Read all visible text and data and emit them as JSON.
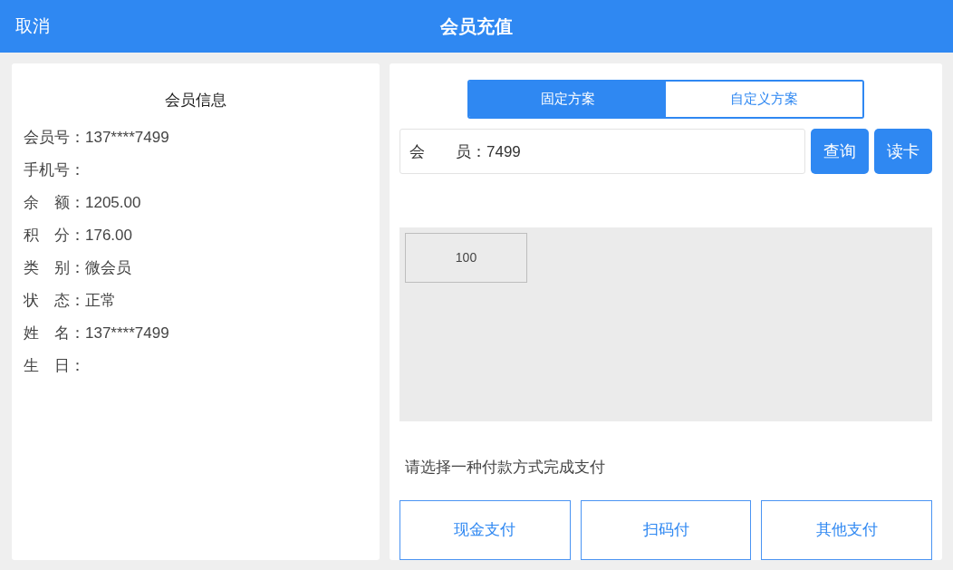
{
  "header": {
    "cancel": "取消",
    "title": "会员充值"
  },
  "member_info": {
    "title": "会员信息",
    "rows": [
      {
        "label": "会员号：",
        "value": "137****7499"
      },
      {
        "label": "手机号：",
        "value": ""
      },
      {
        "label": "余　额：",
        "value": "1205.00"
      },
      {
        "label": "积　分：",
        "value": "176.00"
      },
      {
        "label": "类　别：",
        "value": "微会员"
      },
      {
        "label": "状　态：",
        "value": "正常"
      },
      {
        "label": "姓　名：",
        "value": "137****7499"
      },
      {
        "label": "生　日：",
        "value": ""
      }
    ]
  },
  "tabs": [
    {
      "label": "固定方案",
      "selected": true
    },
    {
      "label": "自定义方案",
      "selected": false
    }
  ],
  "member_field": {
    "label": "会　　员：",
    "value": "7499"
  },
  "actions": [
    "查询",
    "读卡"
  ],
  "plans": [
    "100"
  ],
  "prompt": "请选择一种付款方式完成支付",
  "payments": [
    "现金支付",
    "扫码付",
    "其他支付"
  ]
}
